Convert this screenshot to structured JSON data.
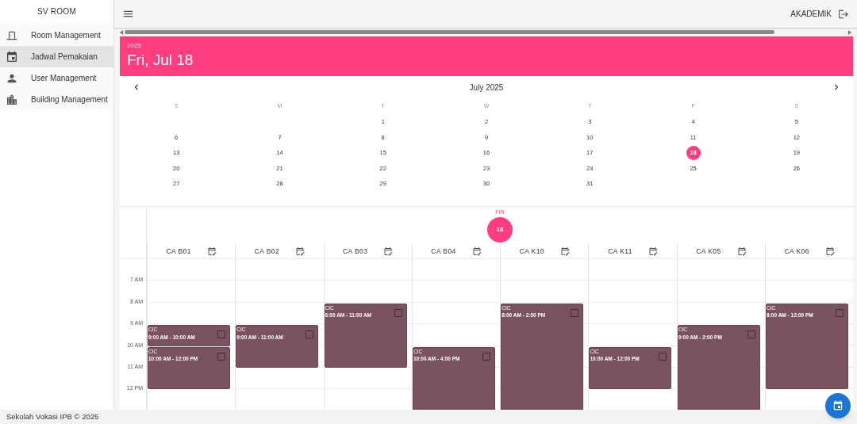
{
  "sidebar": {
    "title": "SV ROOM",
    "items": [
      {
        "label": "Room Management",
        "kind": "door",
        "selected": false
      },
      {
        "label": "Jadwal Pemakaian",
        "kind": "calendar",
        "selected": true
      },
      {
        "label": "User Management",
        "kind": "person",
        "selected": false
      },
      {
        "label": "Building Management",
        "kind": "building",
        "selected": false
      }
    ]
  },
  "topbar": {
    "user": "AKADEMIK"
  },
  "date_header": {
    "year": "2025",
    "date": "Fri, Jul 18"
  },
  "calendar": {
    "month": "July 2025",
    "weekdays": [
      "S",
      "M",
      "T",
      "W",
      "T",
      "F",
      "S"
    ],
    "weeks": [
      {
        "days": [
          {
            "label": "1",
            "selected": false
          },
          {
            "label": "2",
            "selected": false
          },
          {
            "label": "3",
            "selected": false
          },
          {
            "label": "4",
            "selected": false
          },
          {
            "label": "5",
            "selected": false
          }
        ]
      },
      {
        "days": [
          {
            "label": "6",
            "selected": false
          },
          {
            "label": "7",
            "selected": false
          },
          {
            "label": "8",
            "selected": false
          },
          {
            "label": "9",
            "selected": false
          },
          {
            "label": "10",
            "selected": false
          },
          {
            "label": "11",
            "selected": false
          },
          {
            "label": "12",
            "selected": false
          }
        ]
      },
      {
        "days": [
          {
            "label": "13",
            "selected": false
          },
          {
            "label": "14",
            "selected": false
          },
          {
            "label": "15",
            "selected": false
          },
          {
            "label": "16",
            "selected": false
          },
          {
            "label": "17",
            "selected": false
          },
          {
            "label": "18",
            "selected": true
          },
          {
            "label": "19",
            "selected": false
          }
        ]
      },
      {
        "days": [
          {
            "label": "20",
            "selected": false
          },
          {
            "label": "21",
            "selected": false
          },
          {
            "label": "22",
            "selected": false
          },
          {
            "label": "23",
            "selected": false
          },
          {
            "label": "24",
            "selected": false
          },
          {
            "label": "25",
            "selected": false
          },
          {
            "label": "26",
            "selected": false
          }
        ]
      },
      {
        "days": [
          {
            "label": "27",
            "selected": false
          },
          {
            "label": "28",
            "selected": false
          },
          {
            "label": "29",
            "selected": false
          },
          {
            "label": "30",
            "selected": false
          },
          {
            "label": "31",
            "selected": false
          }
        ]
      }
    ]
  },
  "scheduler": {
    "day_name": "FRI",
    "day_number": "18",
    "hours": [
      "7 AM",
      "8 AM",
      "9 AM",
      "10 AM",
      "11 AM",
      "12 PM"
    ],
    "rooms": [
      {
        "name": "CA B01",
        "events": [
          {
            "title": "CIC",
            "time": "9:00 AM - 10:00 AM",
            "checked": false
          },
          {
            "title": "CIC",
            "time": "10:00 AM - 12:00 PM",
            "checked": false
          }
        ]
      },
      {
        "name": "CA B02",
        "events": [
          {
            "title": "CIC",
            "time": "9:00 AM - 11:00 AM",
            "checked": false
          }
        ]
      },
      {
        "name": "CA B03",
        "events": [
          {
            "title": "CIC",
            "time": "8:00 AM - 11:00 AM",
            "checked": false
          }
        ]
      },
      {
        "name": "CA B04",
        "events": [
          {
            "title": "CIC",
            "time": "10:00 AM - 4:00 PM",
            "checked": false
          }
        ]
      },
      {
        "name": "CA K10",
        "events": [
          {
            "title": "CIC",
            "time": "8:00 AM - 2:00 PM",
            "checked": false
          }
        ]
      },
      {
        "name": "CA K11",
        "events": [
          {
            "title": "CIC",
            "time": "10:00 AM - 12:00 PM",
            "checked": false
          }
        ]
      },
      {
        "name": "CA K05",
        "events": [
          {
            "title": "CIC",
            "time": "9:00 AM - 2:00 PM",
            "checked": false
          }
        ]
      },
      {
        "name": "CA K06",
        "events": [
          {
            "title": "CIC",
            "time": "8:00 AM - 12:00 PM",
            "checked": false
          }
        ]
      }
    ]
  },
  "footer": {
    "text": "Sekolah Vokasi IPB © 2025"
  }
}
